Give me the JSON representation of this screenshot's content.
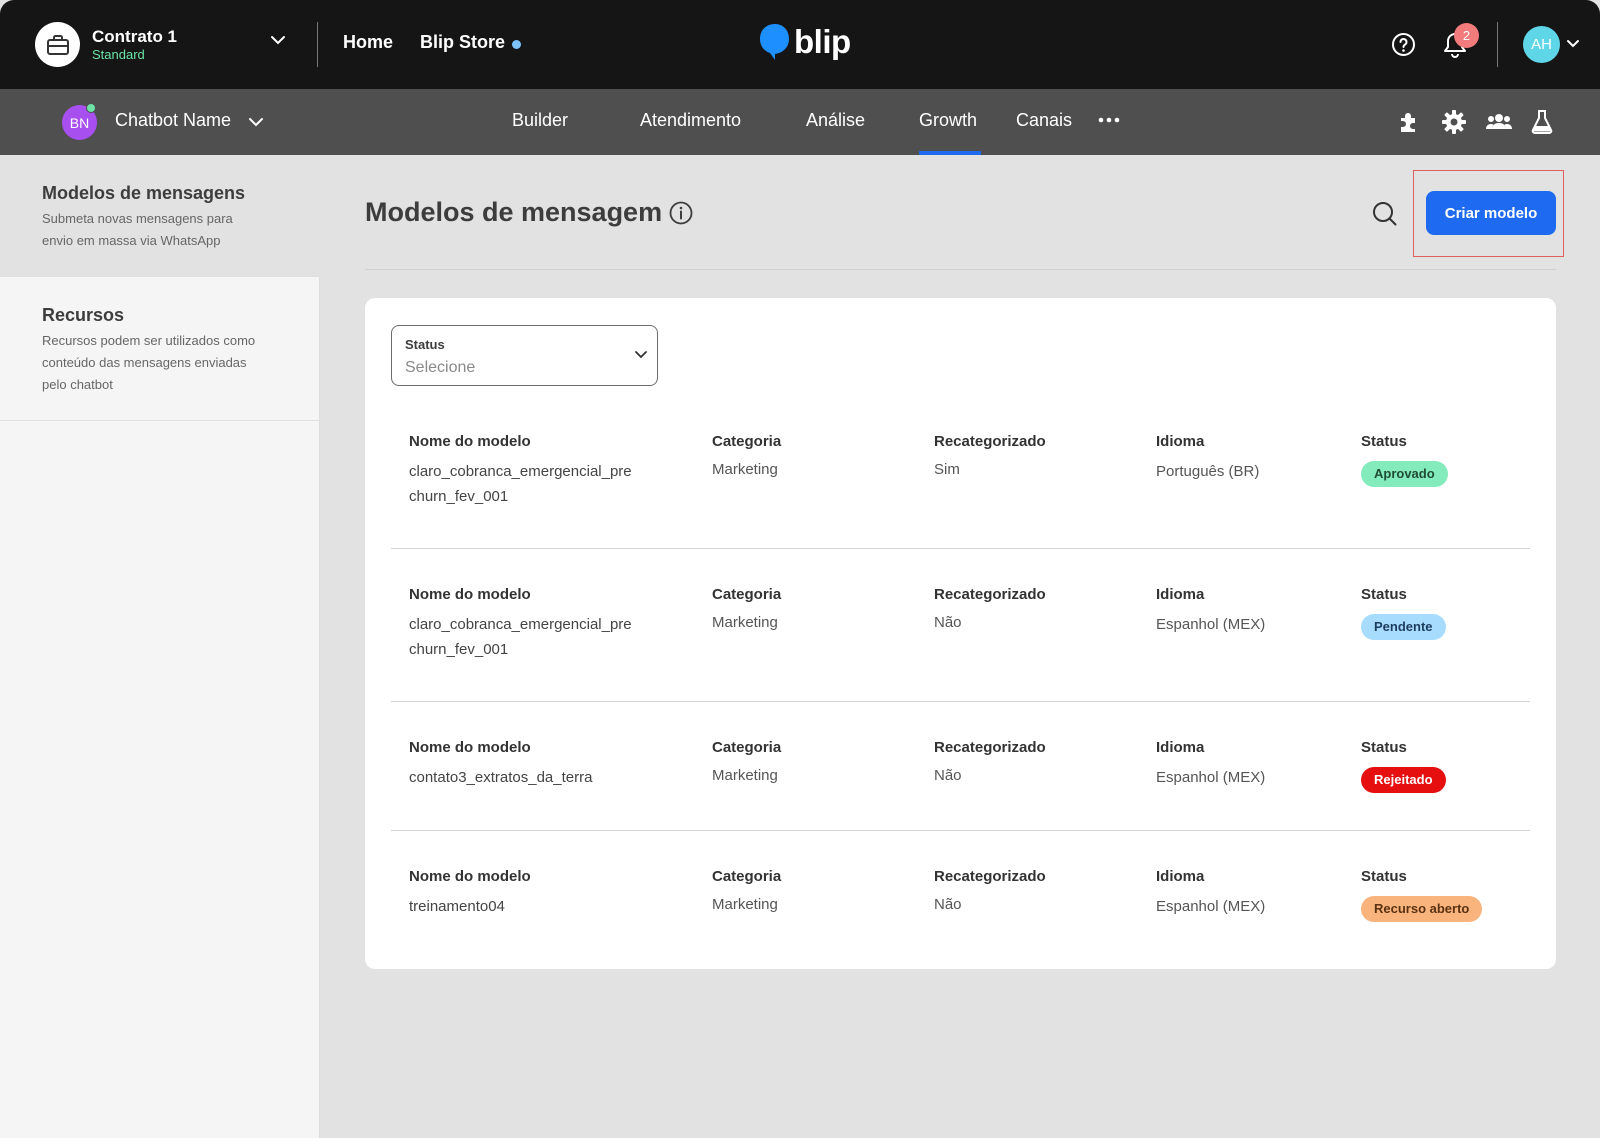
{
  "topbar": {
    "contract_name": "Contrato 1",
    "contract_plan": "Standard",
    "home_label": "Home",
    "store_label": "Blip Store",
    "logo_text": "blip",
    "notification_count": "2",
    "user_initials": "AH"
  },
  "subbar": {
    "bot_initials": "BN",
    "bot_name": "Chatbot Name",
    "tabs": [
      "Builder",
      "Atendimento",
      "Análise",
      "Growth",
      "Canais"
    ],
    "active_tab": "Growth"
  },
  "sidebar": {
    "items": [
      {
        "title": "Modelos de mensagens",
        "description": "Submeta novas mensagens para envio em massa via WhatsApp"
      },
      {
        "title": "Recursos",
        "description": "Recursos podem ser utilizados como conteúdo das mensagens enviadas pelo chatbot"
      }
    ]
  },
  "main": {
    "title": "Modelos de mensagem",
    "create_label": "Criar modelo",
    "filter": {
      "label": "Status",
      "placeholder": "Selecione"
    },
    "columns": [
      "Nome do modelo",
      "Categoria",
      "Recategorizado",
      "Idioma",
      "Status"
    ],
    "rows": [
      {
        "name": "claro_cobranca_emergencial_pre churn_fev_001",
        "category": "Marketing",
        "recategorized": "Sim",
        "language": "Português (BR)",
        "status": "Aprovado"
      },
      {
        "name": "claro_cobranca_emergencial_pre churn_fev_001",
        "category": "Marketing",
        "recategorized": "Não",
        "language": "Espanhol (MEX)",
        "status": "Pendente"
      },
      {
        "name": "contato3_extratos_da_terra",
        "category": "Marketing",
        "recategorized": "Não",
        "language": "Espanhol (MEX)",
        "status": "Rejeitado"
      },
      {
        "name": "treinamento04",
        "category": "Marketing",
        "recategorized": "Não",
        "language": "Espanhol (MEX)",
        "status": "Recurso aberto"
      }
    ]
  },
  "colors": {
    "accent": "#1e6bf1",
    "approved_bg": "#84ebbc",
    "pending_bg": "#a8dcff",
    "rejected_bg": "#e60f0f",
    "appeal_bg": "#f9b47e"
  }
}
